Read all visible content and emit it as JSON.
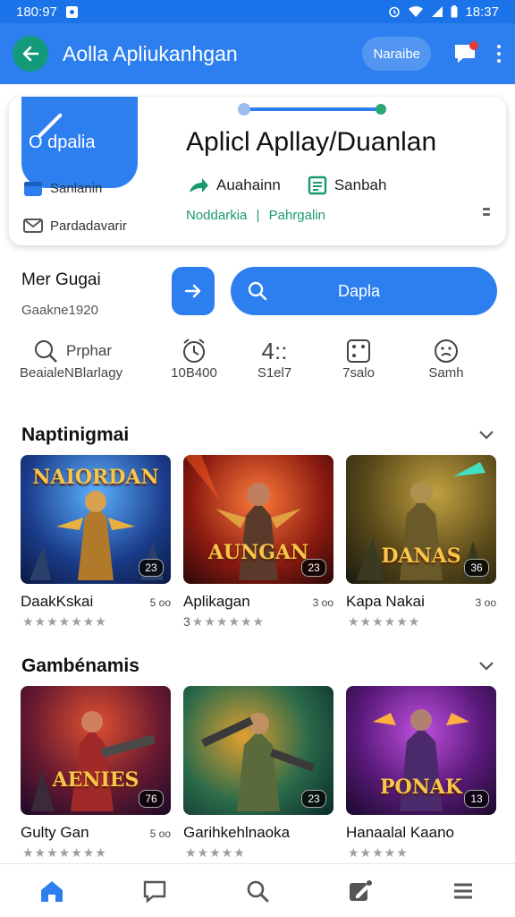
{
  "status_bar": {
    "time_left": "180:97",
    "time_right": "18:37"
  },
  "app_bar": {
    "title": "Aolla Apliukanhgan",
    "chip_label": "Naraibe",
    "back_icon": "arrow-left-icon",
    "chat_icon": "chat-bubble-icon",
    "more_icon": "more-vert-icon"
  },
  "hero": {
    "logo_text": "O dpalia",
    "left_item1": "Sanlanin",
    "left_item2": "Pardadavarir",
    "title": "Aplicl Apllay/Duanlan",
    "meta1": "Auahainn",
    "meta2": "Sanbah",
    "developer": "Noddarkia",
    "separator": "|",
    "category": "Pahrgalin"
  },
  "subsection": {
    "title": "Mer Gugai",
    "subtitle": "Gaakne1920"
  },
  "search": {
    "label": "Dapla"
  },
  "stats": [
    {
      "label": "BeaialeNBlarlagy",
      "icon": "chat-search-icon",
      "top": "Prphar"
    },
    {
      "label": "10B400",
      "icon": "alarm-clock-icon",
      "top": ""
    },
    {
      "label": "S1el7",
      "icon": "age-rating-icon",
      "top": "4::"
    },
    {
      "label": "7salo",
      "icon": "dice-icon",
      "top": ""
    },
    {
      "label": "Samh",
      "icon": "face-icon",
      "top": ""
    }
  ],
  "section1": {
    "title": "Naptinigmai",
    "games": [
      {
        "name": "DaakKskai",
        "size": "5 oo",
        "rating": "",
        "art_title": "NAIORDAN",
        "badge": "23"
      },
      {
        "name": "Aplikagan",
        "size": "3 oo",
        "rating": "3",
        "art_title": "AUNGAN",
        "badge": "23"
      },
      {
        "name": "Kapa Nakai",
        "size": "3 oo",
        "rating": "",
        "art_title": "DANAS",
        "badge": "36"
      }
    ]
  },
  "section2": {
    "title": "Gambénamis",
    "games": [
      {
        "name": "Gulty Gan",
        "size": "5 oo",
        "rating": "",
        "art_title": "AENIES",
        "badge": "76"
      },
      {
        "name": "Garihkehlnaoka",
        "size": "",
        "rating": "",
        "art_title": "",
        "badge": "23"
      },
      {
        "name": "Hanaalal Kaano",
        "size": "",
        "rating": "",
        "art_title": "PONAK",
        "badge": "13"
      }
    ]
  },
  "colors": {
    "primary": "#2d7ff0",
    "accent_green": "#1a9a6a",
    "back_button": "#129a7a"
  },
  "bottom_nav": [
    {
      "icon": "home-icon",
      "active": true
    },
    {
      "icon": "chat-icon",
      "active": false
    },
    {
      "icon": "search-icon",
      "active": false
    },
    {
      "icon": "edit-icon",
      "active": false
    },
    {
      "icon": "menu-icon",
      "active": false
    }
  ]
}
